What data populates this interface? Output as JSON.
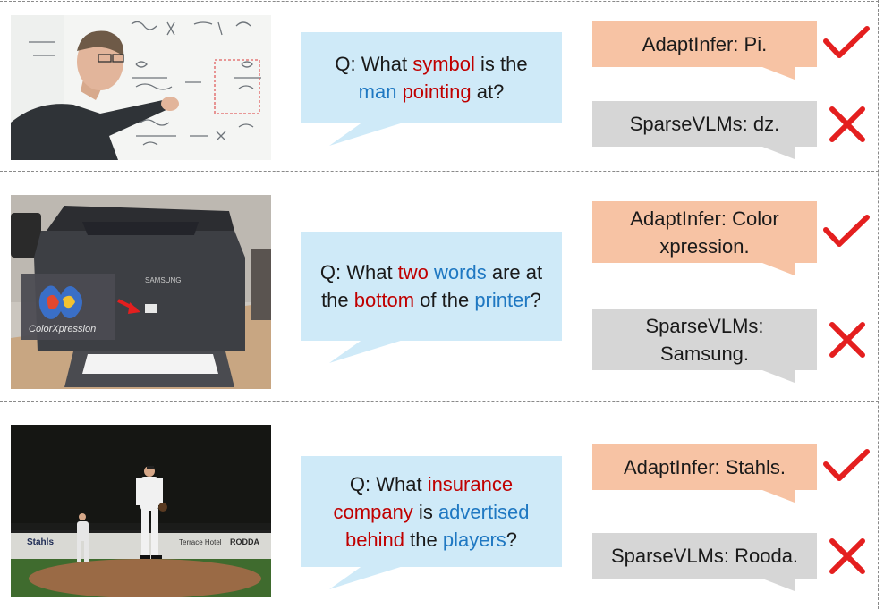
{
  "colors": {
    "keyword_red": "#c00000",
    "keyword_blue": "#1f78c2",
    "question_bg": "#cfeaf8",
    "adaptinfer_bg": "#f7c3a4",
    "sparsevlms_bg": "#d6d6d6",
    "mark_red": "#e41f1f"
  },
  "rows": [
    {
      "image": "man pointing at equations on a whiteboard",
      "question": {
        "q": "Q: What ",
        "w1": "symbol",
        "t1": " is the",
        "w2": "man",
        "sp": " ",
        "w3": "pointing",
        "t2": " at?"
      },
      "answers": [
        {
          "text": "AdaptInfer: Pi.",
          "mark": "check-icon"
        },
        {
          "text": "SparseVLMs: dz.",
          "mark": "cross-icon"
        }
      ]
    },
    {
      "image": "Samsung laser printer with ColorXpression logo inset",
      "image_inset_label": "ColorXpression",
      "image_brand_label": "SAMSUNG",
      "question": {
        "q": "Q: What ",
        "w1": "two",
        "sp": " ",
        "w2": "words",
        "t1": " are at",
        "t2": "the ",
        "w3": "bottom",
        "t3": " of the ",
        "w4": "printer",
        "t4": "?"
      },
      "answers": [
        {
          "line1": "AdaptInfer: Color",
          "line2": "xpression.",
          "mark": "check-icon"
        },
        {
          "line1": "SparseVLMs:",
          "line2": "Samsung.",
          "mark": "cross-icon"
        }
      ]
    },
    {
      "image": "baseball players on a field at night with outfield advertisements",
      "image_sign_labels": [
        "Stahls",
        "Terrace Hotel",
        "RODDA"
      ],
      "question": {
        "q": "Q: What ",
        "w1": "insurance",
        "w2": "company",
        "t1": " is ",
        "w3": "advertised",
        "w4": "behind",
        "t2": " the ",
        "w5": "players",
        "t3": "?"
      },
      "answers": [
        {
          "text": "AdaptInfer: Stahls.",
          "mark": "check-icon"
        },
        {
          "text": "SparseVLMs: Rooda.",
          "mark": "cross-icon"
        }
      ]
    }
  ]
}
